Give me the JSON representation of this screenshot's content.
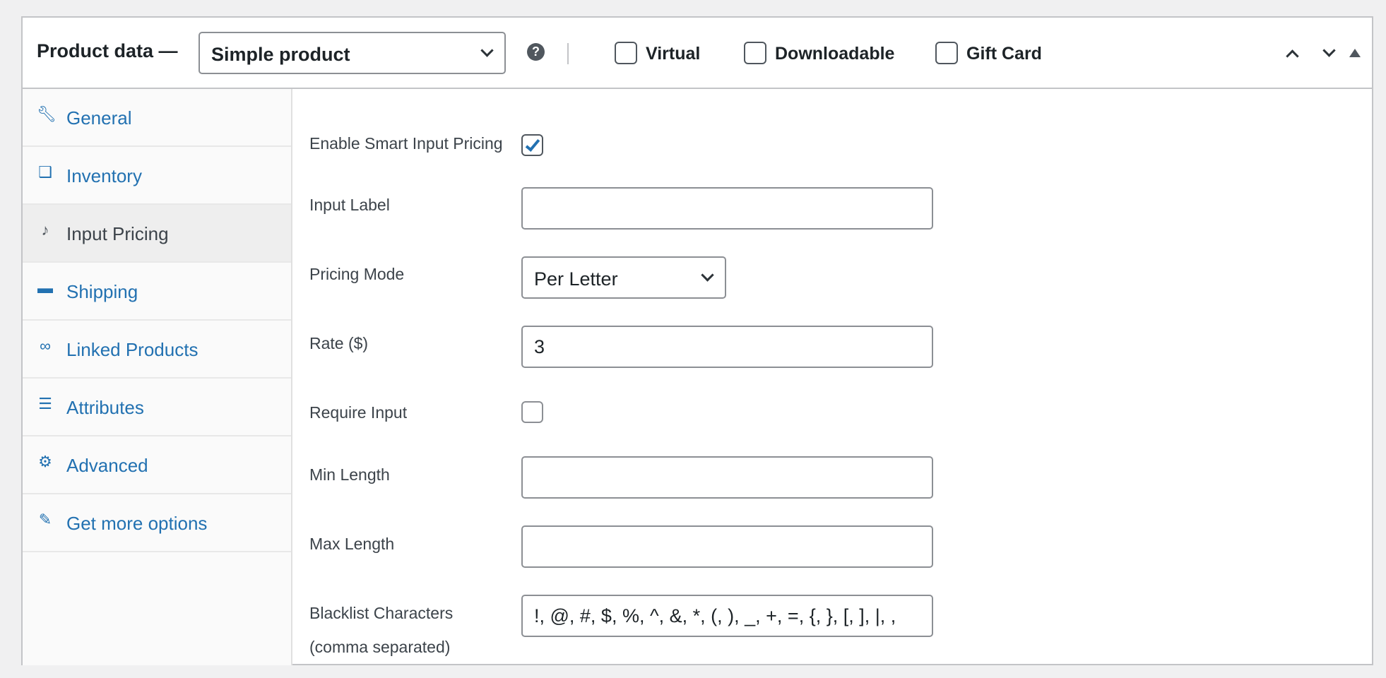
{
  "header": {
    "title": "Product data —",
    "product_type": "Simple product",
    "help_icon": "?",
    "checkboxes": [
      {
        "label": "Virtual",
        "checked": false
      },
      {
        "label": "Downloadable",
        "checked": false
      },
      {
        "label": "Gift Card",
        "checked": false
      }
    ],
    "controls": [
      "chevron-up-icon",
      "chevron-down-icon",
      "triangle-up-icon"
    ]
  },
  "sidebar": {
    "items": [
      {
        "label": "General",
        "icon": "wrench-icon",
        "active": false
      },
      {
        "label": "Inventory",
        "icon": "tag-icon",
        "active": false
      },
      {
        "label": "Input Pricing",
        "icon": "bell-icon",
        "active": true
      },
      {
        "label": "Shipping",
        "icon": "truck-icon",
        "active": false
      },
      {
        "label": "Linked Products",
        "icon": "link-icon",
        "active": false
      },
      {
        "label": "Attributes",
        "icon": "list-card-icon",
        "active": false
      },
      {
        "label": "Advanced",
        "icon": "gear-icon",
        "active": false
      },
      {
        "label": "Get more options",
        "icon": "plugin-icon",
        "active": false
      }
    ]
  },
  "form": {
    "enable_smart_pricing": {
      "label": "Enable Smart Input Pricing",
      "checked": true
    },
    "input_label": {
      "label": "Input Label",
      "value": ""
    },
    "pricing_mode": {
      "label": "Pricing Mode",
      "value": "Per Letter"
    },
    "rate": {
      "label": "Rate ($)",
      "value": "3"
    },
    "require_input": {
      "label": "Require Input",
      "checked": false
    },
    "min_length": {
      "label": "Min Length",
      "value": ""
    },
    "max_length": {
      "label": "Max Length",
      "value": ""
    },
    "blacklist": {
      "label_line1": "Blacklist Characters",
      "label_line2": "(comma separated)",
      "value": "!, @, #, $, %, ^, &, *, (, ), _, +, =, {, }, [, ], |, ,"
    }
  },
  "colors": {
    "link": "#2271b1",
    "active_text": "#3c434a",
    "border": "#8c8f94",
    "page_bg": "#f0f0f1"
  }
}
